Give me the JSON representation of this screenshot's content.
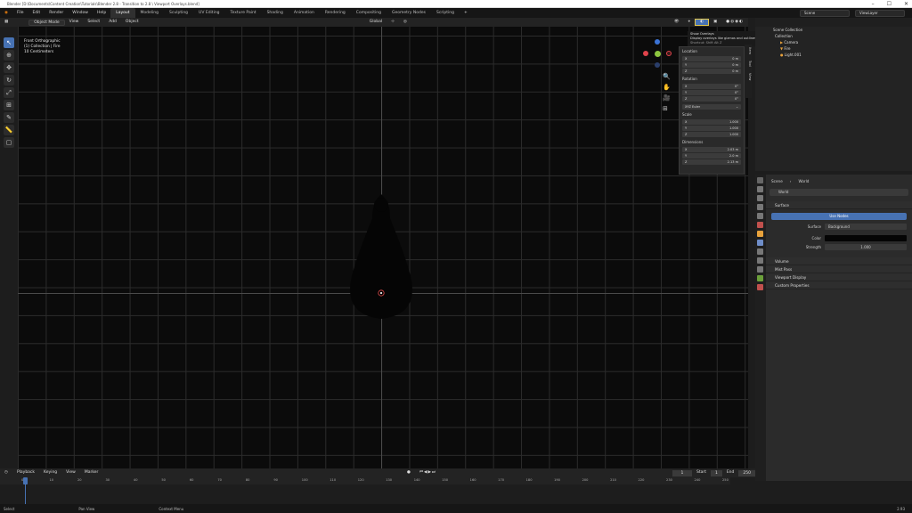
{
  "window": {
    "title": "Blender [D:\\Documents\\Content Creation\\Tutorials\\Blender 2.8 - Transition to 2.8 \\ Viewport Overlays.blend]"
  },
  "menu": [
    "File",
    "Edit",
    "Render",
    "Window",
    "Help"
  ],
  "workspaces": [
    "Layout",
    "Modeling",
    "Sculpting",
    "UV Editing",
    "Texture Paint",
    "Shading",
    "Animation",
    "Rendering",
    "Compositing",
    "Geometry Nodes",
    "Scripting"
  ],
  "active_workspace": "Layout",
  "scene": {
    "scene_name": "Scene",
    "view_layer": "ViewLayer"
  },
  "viewport_header": {
    "mode": "Object Mode",
    "menus": [
      "View",
      "Select",
      "Add",
      "Object"
    ],
    "transform": "Global"
  },
  "viewport_info": {
    "view": "Front Orthographic",
    "collection": "(1) Collection | Fire",
    "units": "10 Centimeters"
  },
  "tooltip": {
    "title": "Show Overlays",
    "desc": "Display overlays like gizmos and outlines",
    "python": "Shortcut: Shift Alt Z"
  },
  "npanel": {
    "location_label": "Location",
    "location": [
      {
        "axis": "X",
        "value": "0 m"
      },
      {
        "axis": "Y",
        "value": "0 m"
      },
      {
        "axis": "Z",
        "value": "0 m"
      }
    ],
    "rotation_label": "Rotation",
    "rotation": [
      {
        "axis": "X",
        "value": "0°"
      },
      {
        "axis": "Y",
        "value": "0°"
      },
      {
        "axis": "Z",
        "value": "0°"
      }
    ],
    "rotation_mode": "XYZ Euler",
    "scale_label": "Scale",
    "scale": [
      {
        "axis": "X",
        "value": "1.000"
      },
      {
        "axis": "Y",
        "value": "1.000"
      },
      {
        "axis": "Z",
        "value": "1.000"
      }
    ],
    "dimensions_label": "Dimensions",
    "dimensions": [
      {
        "axis": "X",
        "value": "2.03 m"
      },
      {
        "axis": "Y",
        "value": "2.0 m"
      },
      {
        "axis": "Z",
        "value": "2.13 m"
      }
    ],
    "tabs": [
      "Item",
      "Tool",
      "View"
    ]
  },
  "outliner": {
    "root": "Scene Collection",
    "rows": [
      "Collection",
      "Camera",
      "Fire",
      "Light.001"
    ]
  },
  "properties": {
    "breadcrumb_scene": "Scene",
    "breadcrumb_world": "World",
    "world_name": "World",
    "surface_header": "Surface",
    "use_nodes": "Use Nodes",
    "surface_label": "Surface",
    "surface_value": "Background",
    "color_label": "Color",
    "strength_label": "Strength",
    "strength_value": "1.000",
    "sections": [
      "Volume",
      "Mist Pass",
      "Viewport Display",
      "Custom Properties"
    ]
  },
  "timeline": {
    "menus": [
      "Playback",
      "Keying",
      "View",
      "Marker"
    ],
    "current_frame": "1",
    "start_label": "Start",
    "start": "1",
    "end_label": "End",
    "end": "250",
    "ticks": [
      "0",
      "10",
      "20",
      "30",
      "40",
      "50",
      "60",
      "70",
      "80",
      "90",
      "100",
      "110",
      "120",
      "130",
      "140",
      "150",
      "160",
      "170",
      "180",
      "190",
      "200",
      "210",
      "220",
      "230",
      "240",
      "250"
    ]
  },
  "statusbar": {
    "select": "Select",
    "pan": "Pan View",
    "context": "Context Menu",
    "version": "2.93"
  },
  "colors": {
    "accent": "#4772b3",
    "active_highlight": "#e2c548",
    "gizmo_x": "#e0434b",
    "gizmo_y": "#8dc63f",
    "gizmo_z": "#3b73d6"
  }
}
